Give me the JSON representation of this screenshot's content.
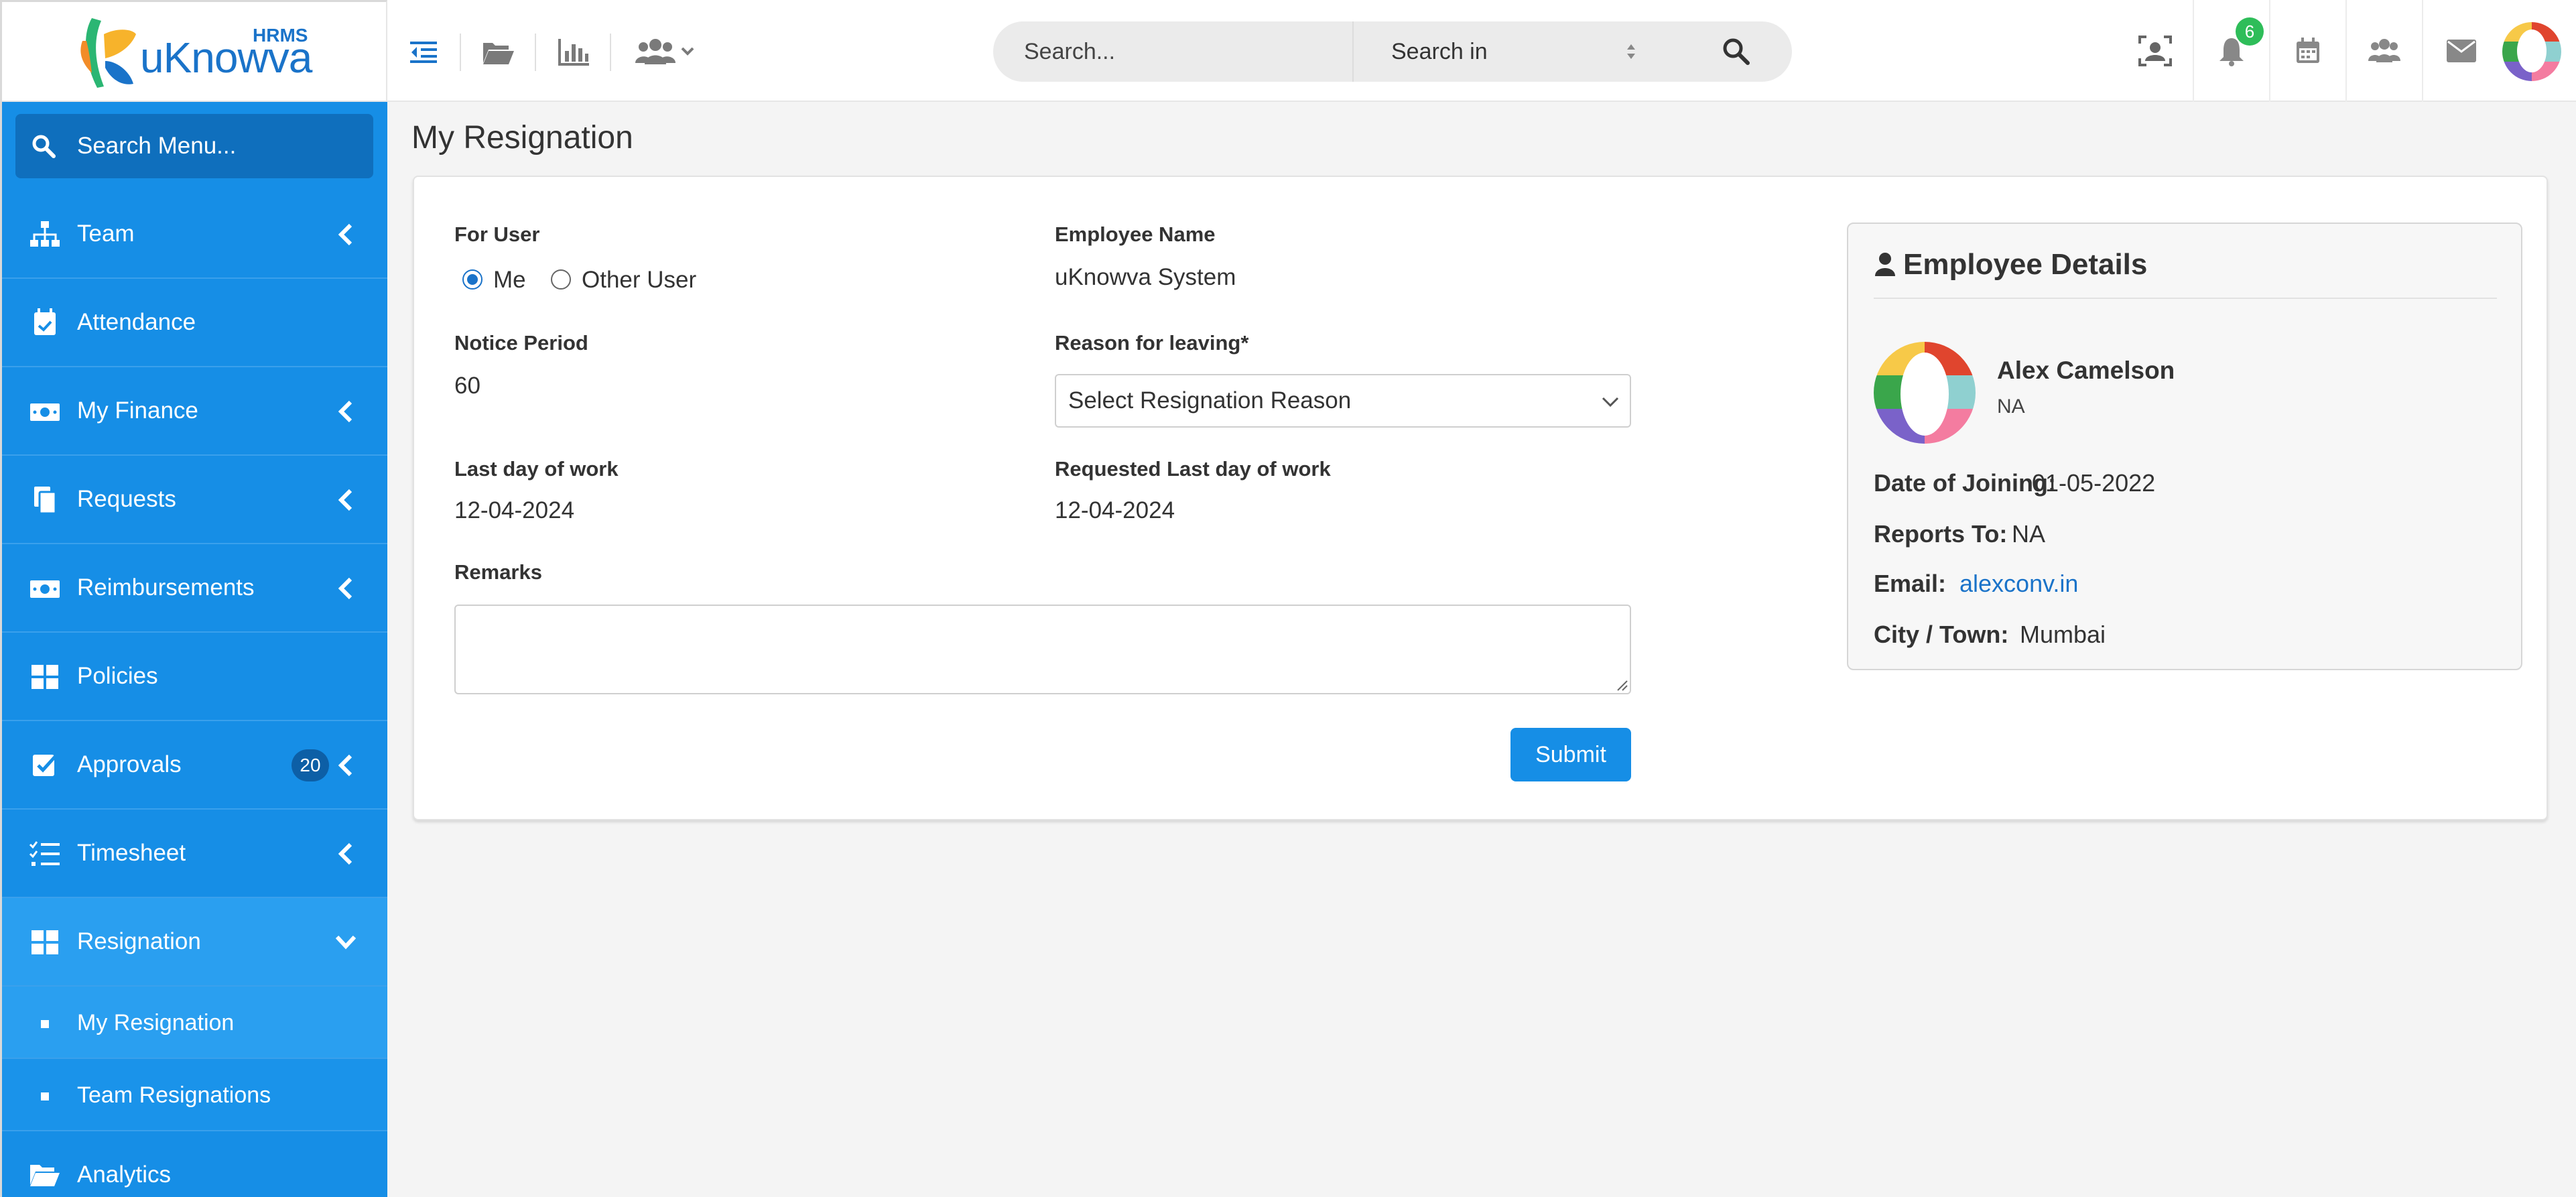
{
  "brand": {
    "name": "uKnowva",
    "tag": "HRMS"
  },
  "header": {
    "search_placeholder": "Search...",
    "search_in": "Search in",
    "notification_count": "6",
    "icons": [
      "menu-collapse-icon",
      "folder-open-icon",
      "bar-chart-icon",
      "users-icon",
      "face-scan-icon",
      "bell-icon",
      "calendar-icon",
      "team-icon",
      "envelope-icon"
    ]
  },
  "sidebar": {
    "search_label": "Search Menu...",
    "items": [
      {
        "label": "Team",
        "icon": "sitemap-icon"
      },
      {
        "label": "Attendance",
        "icon": "calendar-check-icon"
      },
      {
        "label": "My Finance",
        "icon": "money-icon"
      },
      {
        "label": "Requests",
        "icon": "copy-icon"
      },
      {
        "label": "Reimbursements",
        "icon": "money-icon"
      },
      {
        "label": "Policies",
        "icon": "grid-icon"
      },
      {
        "label": "Approvals",
        "icon": "check-square-icon",
        "count": "20"
      },
      {
        "label": "Timesheet",
        "icon": "list-check-icon"
      },
      {
        "label": "Resignation",
        "icon": "grid-icon"
      },
      {
        "label": "Analytics",
        "icon": "folder-open-icon"
      }
    ],
    "sub_items": [
      "My Resignation",
      "Team Resignations"
    ]
  },
  "page": {
    "title": "My Resignation",
    "form": {
      "for_user_label": "For User",
      "radio_me": "Me",
      "radio_other": "Other User",
      "employee_name_label": "Employee Name",
      "employee_name_value": "uKnowva System",
      "notice_period_label": "Notice Period",
      "notice_period_value": "60",
      "reason_label": "Reason for leaving*",
      "reason_placeholder": "Select Resignation Reason",
      "last_day_label": "Last day of work",
      "last_day_value": "12-04-2024",
      "requested_last_day_label": "Requested Last day of work",
      "requested_last_day_value": "12-04-2024",
      "remarks_label": "Remarks",
      "submit_label": "Submit"
    },
    "employee_details": {
      "title": "Employee Details",
      "name": "Alex Camelson",
      "designation": "NA",
      "doj_label": "Date of Joining:",
      "doj_value": "01-05-2022",
      "reports_to_label": "Reports To:",
      "reports_to_value": "NA",
      "email_label": "Email:",
      "email_value": "alexconv.in",
      "city_label": "City / Town:",
      "city_value": "Mumbai"
    }
  },
  "colors": {
    "sidebar": "#168ee6",
    "accent": "#1a73c9",
    "badge": "#2ebd59"
  }
}
